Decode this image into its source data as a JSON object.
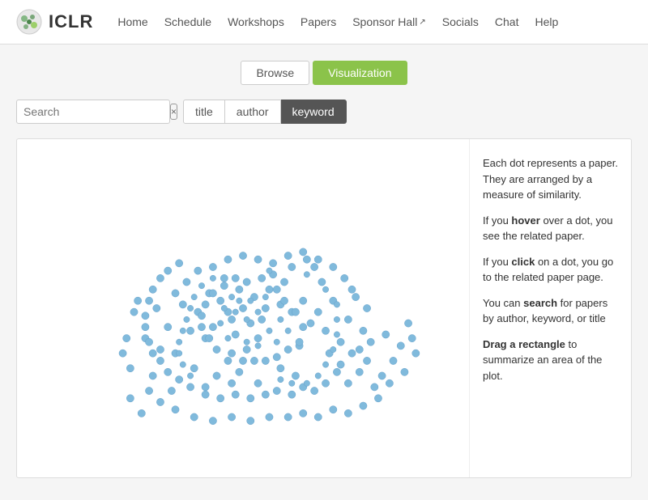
{
  "header": {
    "logo_text": "ICLR",
    "nav_items": [
      {
        "label": "Home",
        "external": false
      },
      {
        "label": "Schedule",
        "external": false
      },
      {
        "label": "Workshops",
        "external": false
      },
      {
        "label": "Papers",
        "external": false
      },
      {
        "label": "Sponsor Hall",
        "external": true
      },
      {
        "label": "Socials",
        "external": false
      },
      {
        "label": "Chat",
        "external": false
      },
      {
        "label": "Help",
        "external": false
      }
    ]
  },
  "toggle": {
    "browse_label": "Browse",
    "visualization_label": "Visualization"
  },
  "search": {
    "placeholder": "Search",
    "clear_label": "×"
  },
  "filters": {
    "title_label": "title",
    "author_label": "author",
    "keyword_label": "keyword"
  },
  "info": {
    "line1": "Each dot represents a paper. They are arranged by a measure of similarity.",
    "line2_prefix": "If you ",
    "line2_hover": "hover",
    "line2_suffix": " over a dot, you see the related paper.",
    "line3_prefix": "If you ",
    "line3_click": "click",
    "line3_suffix": " on a dot, you go to the related paper page.",
    "line4_prefix": "You can ",
    "line4_search": "search",
    "line4_suffix": " for papers by author, keyword, or title",
    "line5_drag": "Drag a rectangle",
    "line5_suffix": " to summarize an area of the plot."
  }
}
